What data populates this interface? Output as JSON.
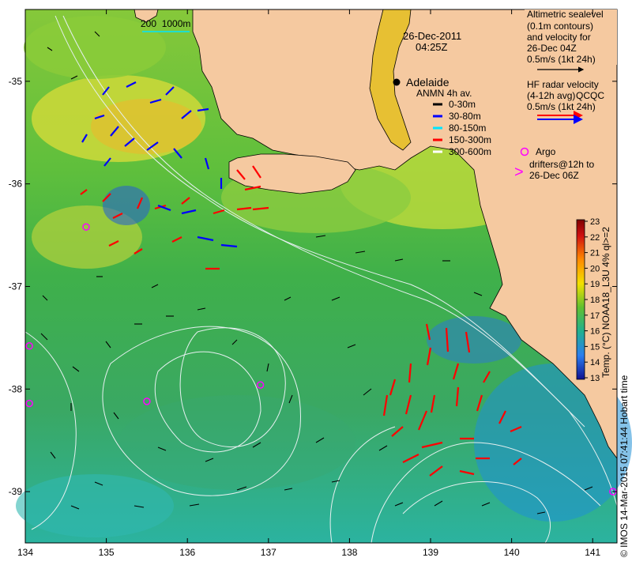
{
  "header": {
    "date": "26-Dec-2011",
    "time": "04:25Z"
  },
  "scale_label": "200  1000m",
  "city": {
    "name": "Adelaide"
  },
  "legend_sealevel": {
    "lines": [
      "Altimetric sealevel",
      "(0.1m contours)",
      "and velocity for",
      "26-Dec 04Z",
      "0.5m/s (1kt 24h)"
    ]
  },
  "legend_hf": {
    "lines": [
      "HF radar velocity",
      "(4-12h avg)",
      "0.5m/s (1kt 24h)"
    ],
    "overlap_text": "QCQC"
  },
  "legend_anmn": {
    "title": "ANMN 4h av.",
    "items": [
      {
        "label": "0-30m",
        "color": "#000000"
      },
      {
        "label": "30-80m",
        "color": "#0000ff"
      },
      {
        "label": "80-150m",
        "color": "#00e5ff"
      },
      {
        "label": "150-300m",
        "color": "#ff0000"
      },
      {
        "label": "300-600m",
        "color": "#ffffff"
      }
    ]
  },
  "legend_argo": {
    "lines": [
      "Argo",
      "drifters@12h to",
      "26-Dec 06Z"
    ],
    "color": "#ff00ff"
  },
  "axes": {
    "x_ticks": [
      "134",
      "135",
      "136",
      "137",
      "138",
      "139",
      "140",
      "141"
    ],
    "y_ticks": [
      "-35",
      "-36",
      "-37",
      "-38",
      "-39"
    ]
  },
  "colorbar": {
    "ticks": [
      "23",
      "22",
      "21",
      "20",
      "19",
      "18",
      "17",
      "16",
      "15",
      "14",
      "13"
    ],
    "label": "Temp. (°C) NOAA18_L3U 4% ql>=2"
  },
  "footer": {
    "copyright": "© IMOS 14-Mar-2015 07:41:44 Hobart time"
  },
  "colors": {
    "land": "#f5c9a0",
    "frame": "#000000",
    "contour": "#e6f0f0"
  },
  "chart_data": {
    "type": "heatmap",
    "xlim": [
      134,
      141.3
    ],
    "ylim": [
      -39.5,
      -34.3
    ],
    "argo_positions": [
      [
        134.75,
        -36.42
      ],
      [
        136.9,
        -37.96
      ],
      [
        135.5,
        -38.12
      ],
      [
        134.05,
        -37.58
      ],
      [
        134.05,
        -38.14
      ],
      [
        141.25,
        -39.0
      ]
    ]
  }
}
